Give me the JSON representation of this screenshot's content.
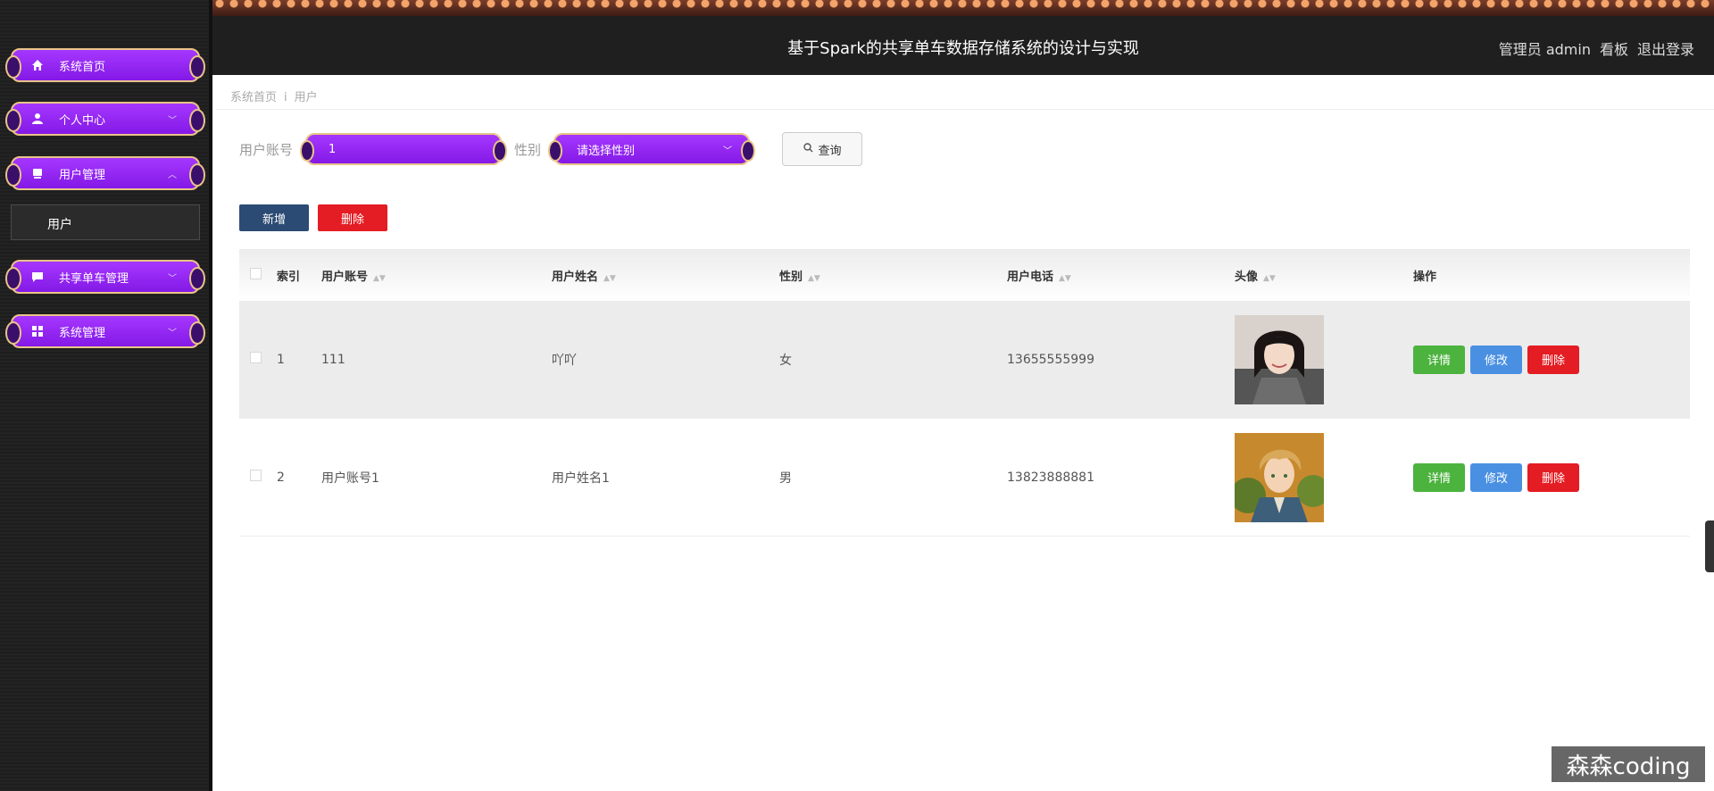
{
  "header": {
    "title": "基于Spark的共享单车数据存储系统的设计与实现",
    "admin_label": "管理员 admin",
    "dashboard_label": "看板",
    "logout_label": "退出登录"
  },
  "sidebar": {
    "items": [
      {
        "label": "系统首页",
        "icon": "home-icon"
      },
      {
        "label": "个人中心",
        "icon": "user-icon"
      },
      {
        "label": "用户管理",
        "icon": "user-manage-icon"
      },
      {
        "label": "共享单车管理",
        "icon": "chat-icon"
      },
      {
        "label": "系统管理",
        "icon": "grid-icon"
      }
    ],
    "submenu_label": "用户"
  },
  "breadcrumb": {
    "home": "系统首页",
    "current": "用户"
  },
  "search": {
    "account_label": "用户账号",
    "account_value": "1",
    "gender_label": "性别",
    "gender_placeholder": "请选择性别",
    "query_label": "查询"
  },
  "actions": {
    "add_label": "新增",
    "delete_label": "删除"
  },
  "table": {
    "headers": [
      "索引",
      "用户账号",
      "用户姓名",
      "性别",
      "用户电话",
      "头像",
      "操作"
    ],
    "rows": [
      {
        "index": "1",
        "account": "111",
        "name": "吖吖",
        "gender": "女",
        "phone": "13655555999",
        "avatar": "avatar-photo-woman"
      },
      {
        "index": "2",
        "account": "用户账号1",
        "name": "用户姓名1",
        "gender": "男",
        "phone": "13823888881",
        "avatar": "avatar-anime-man"
      }
    ],
    "op_labels": {
      "detail": "详情",
      "edit": "修改",
      "delete": "删除"
    }
  },
  "watermark": "森森coding"
}
